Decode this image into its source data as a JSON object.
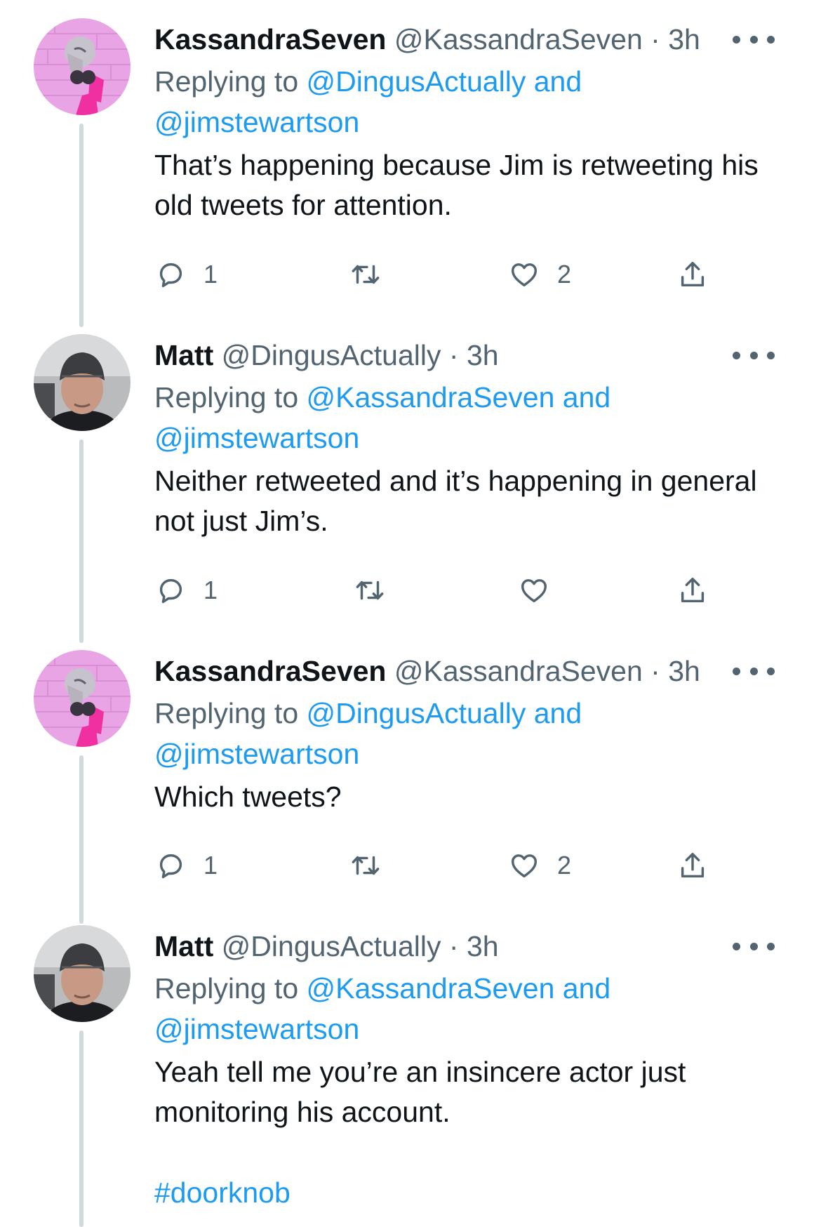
{
  "tweets": [
    {
      "name": "KassandraSeven",
      "handle": "@KassandraSeven",
      "dot": "·",
      "time": "3h",
      "replying_prefix": "Replying to ",
      "reply_link_1": "@DingusActually and",
      "reply_link_2": "@jimstewartson",
      "text_lines": [
        "That’s happening because Jim is retweeting his",
        "old tweets for attention."
      ],
      "reply_count": "1",
      "like_count": "2",
      "avatar": "kassandra-avatar"
    },
    {
      "name": "Matt",
      "handle": "@DingusActually",
      "dot": "·",
      "time": "3h",
      "replying_prefix": "Replying to ",
      "reply_link_1": "@KassandraSeven and",
      "reply_link_2": "@jimstewartson",
      "text_lines": [
        "Neither retweeted and it’s happening in general",
        "not just Jim’s."
      ],
      "reply_count": "1",
      "like_count": "",
      "avatar": "matt-avatar"
    },
    {
      "name": "KassandraSeven",
      "handle": "@KassandraSeven",
      "dot": "·",
      "time": "3h",
      "replying_prefix": "Replying to ",
      "reply_link_1": "@DingusActually and",
      "reply_link_2": "@jimstewartson",
      "text_lines": [
        "Which tweets?"
      ],
      "reply_count": "1",
      "like_count": "2",
      "avatar": "kassandra-avatar"
    },
    {
      "name": "Matt",
      "handle": "@DingusActually",
      "dot": "·",
      "time": "3h",
      "replying_prefix": "Replying to ",
      "reply_link_1": "@KassandraSeven and",
      "reply_link_2": "@jimstewartson",
      "text_lines": [
        "Yeah tell me you’re an insincere actor just",
        "monitoring his account."
      ],
      "hashtag": "#doorknob",
      "avatar": "matt-avatar"
    }
  ],
  "colors": {
    "link": "#1d9bf0",
    "secondary_text": "#536471",
    "primary_text": "#0f1419",
    "thread_line": "#cfd9de"
  },
  "icons": [
    "reply-icon",
    "retweet-icon",
    "like-icon",
    "share-icon",
    "more-icon"
  ]
}
